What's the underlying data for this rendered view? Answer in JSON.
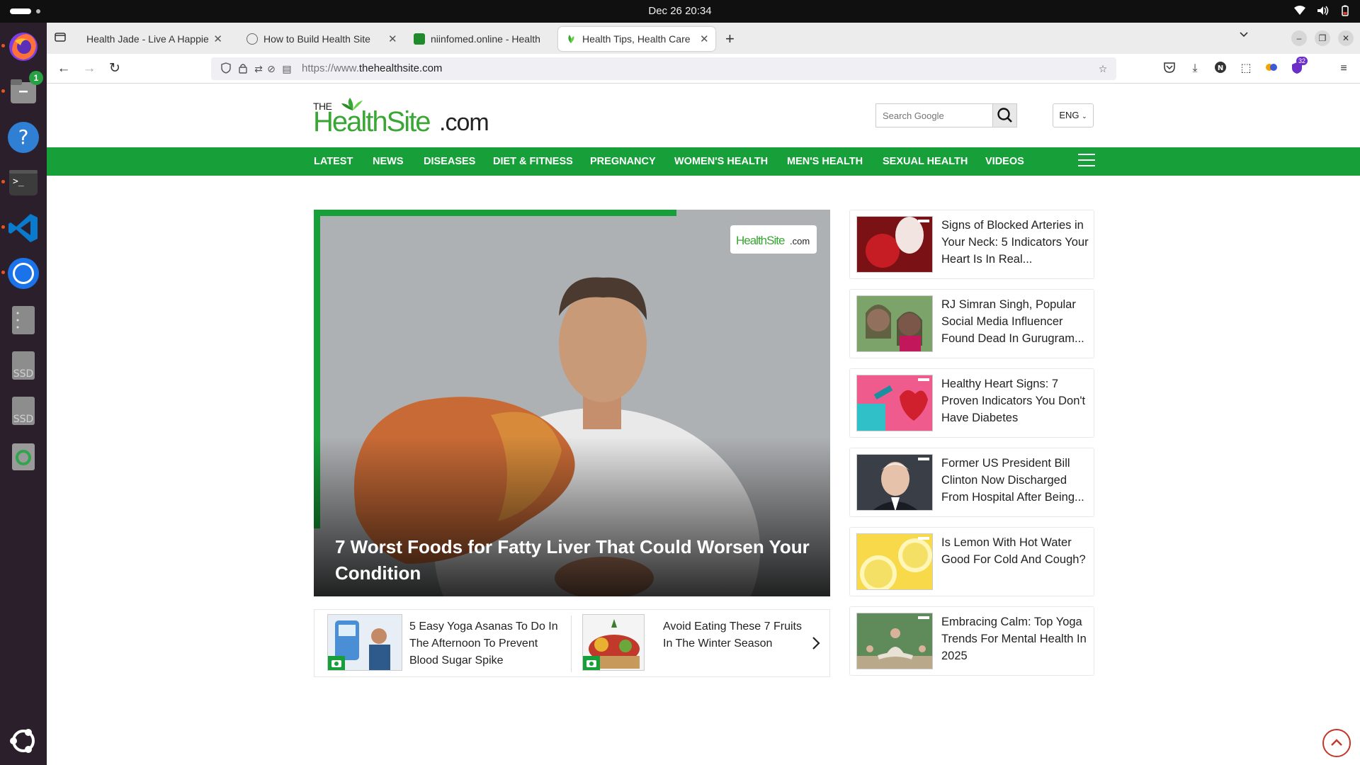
{
  "system": {
    "clock": "Dec 26  20:34",
    "dock_badge": "1",
    "dock_items": [
      "firefox-icon",
      "files-icon",
      "help-icon",
      "terminal-icon",
      "vscode-icon",
      "chromium-icon",
      "disk-manager-icon",
      "ssd-drive-icon",
      "ssd-drive-icon",
      "trash-icon",
      "ubuntu-apps-icon"
    ],
    "ssd_label": "SSD"
  },
  "browser": {
    "tabs": [
      {
        "title": "Health Jade - Live A Happier",
        "active": false
      },
      {
        "title": "How to Build Health Site",
        "active": false
      },
      {
        "title": "niinfomed.online - Health",
        "active": false
      },
      {
        "title": "Health Tips, Health Care",
        "active": true
      }
    ],
    "url_prefix": "https://www.",
    "url_domain": "thehealthsite.com",
    "extension_badge": "32"
  },
  "site": {
    "logo_the": "THE",
    "logo_health": "HealthSite",
    "logo_com": ".com",
    "search_placeholder": "Search Google",
    "language": "ENG",
    "nav": [
      "LATEST",
      "NEWS",
      "DISEASES",
      "DIET & FITNESS",
      "PREGNANCY",
      "WOMEN'S HEALTH",
      "MEN'S HEALTH",
      "SEXUAL HEALTH",
      "VIDEOS"
    ],
    "hero_headline": "7 Worst Foods for Fatty Liver That Could Worsen Your Condition",
    "carousel": [
      "5 Easy Yoga Asanas To Do In The Afternoon To Prevent Blood Sugar Spike",
      "Avoid Eating These 7 Fruits In The Winter Season"
    ],
    "sidebar": [
      "Signs of Blocked Arteries in Your Neck: 5 Indicators Your Heart Is In Real...",
      "RJ Simran Singh, Popular Social Media Influencer Found Dead In Gurugram...",
      "Healthy Heart Signs: 7 Proven Indicators You Don't Have Diabetes",
      "Former US President Bill Clinton Now Discharged From Hospital After Being...",
      "Is Lemon With Hot Water Good For Cold And Cough?",
      "Embracing Calm: Top Yoga Trends For Mental Health In 2025"
    ]
  },
  "colors": {
    "brand_green": "#17a03a",
    "dock_bg": "#2b1f2c",
    "accent_orange": "#e95420"
  }
}
